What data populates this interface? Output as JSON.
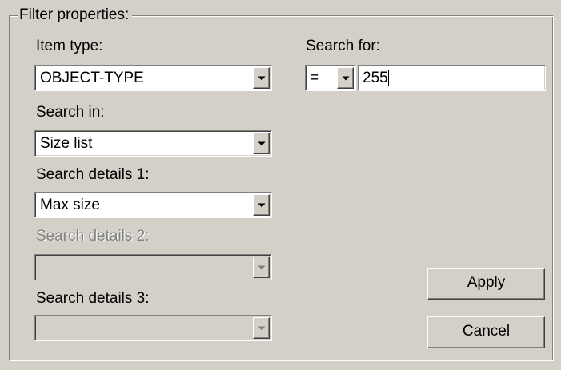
{
  "filter": {
    "group_title": "Filter properties:",
    "item_type": {
      "label": "Item type:",
      "value": "OBJECT-TYPE"
    },
    "search_in": {
      "label": "Search in:",
      "value": "Size list"
    },
    "search_details_1": {
      "label": "Search details 1:",
      "value": "Max size"
    },
    "search_details_2": {
      "label": "Search details 2:",
      "value": ""
    },
    "search_details_3": {
      "label": "Search details 3:",
      "value": ""
    },
    "search_for": {
      "label": "Search for:",
      "operator": "=",
      "value": "255"
    }
  },
  "buttons": {
    "apply_label": "Apply",
    "cancel_label": "Cancel"
  },
  "icons": {
    "dropdown": "chevron-down-icon"
  },
  "colors": {
    "window_bg": "#d4d0c8",
    "field_bg": "#ffffff",
    "disabled_text": "#808080"
  }
}
